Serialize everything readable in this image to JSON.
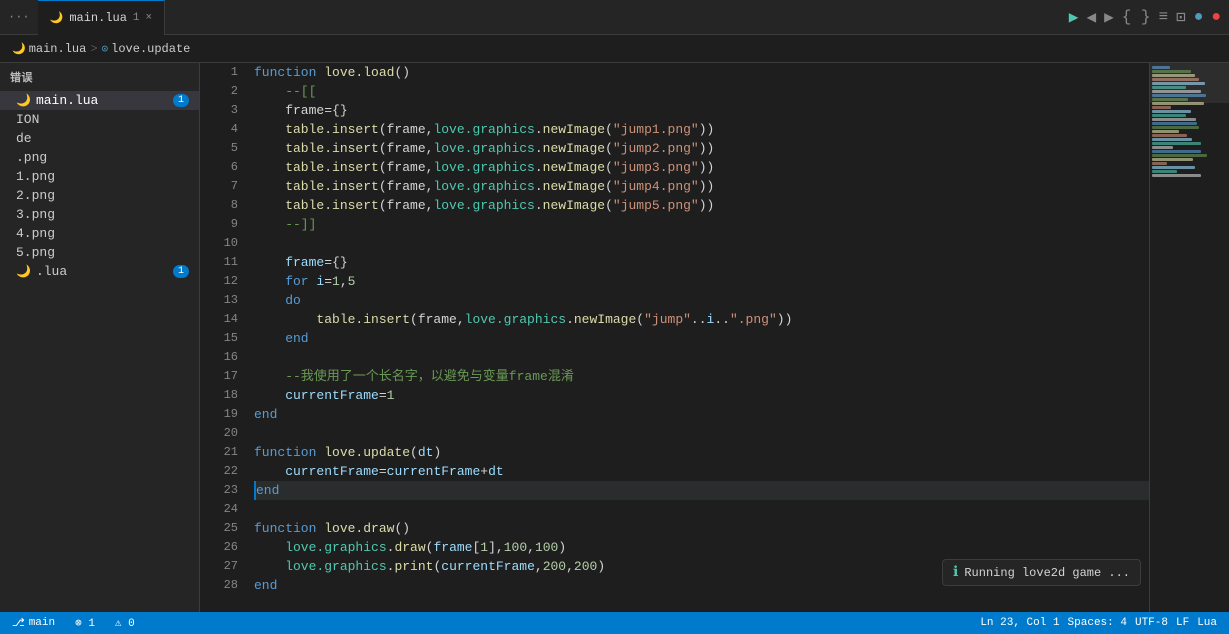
{
  "titlebar": {
    "ellipsis": "···",
    "tab_label": "main.lua",
    "tab_badge": "1",
    "tab_close": "×",
    "actions": [
      "▶",
      "◀",
      "▶",
      "{ }",
      "≡",
      "⊡",
      "●",
      "●"
    ]
  },
  "breadcrumb": {
    "file": "main.lua",
    "separator": ">",
    "symbol": "love.update"
  },
  "sidebar": {
    "sections": [
      {
        "name": "错误",
        "items": [
          {
            "label": "main.lua",
            "badge": "1",
            "active": true
          },
          {
            "label": "ION",
            "badge": null
          },
          {
            "label": "de",
            "badge": null
          },
          {
            "label": ".png",
            "badge": null
          },
          {
            "label": "1.png",
            "badge": null
          },
          {
            "label": "2.png",
            "badge": null
          },
          {
            "label": "3.png",
            "badge": null
          },
          {
            "label": "4.png",
            "badge": null
          },
          {
            "label": "5.png",
            "badge": null
          },
          {
            "label": ".lua",
            "badge": "1"
          }
        ]
      }
    ]
  },
  "code": {
    "lines": [
      {
        "num": 1,
        "tokens": [
          {
            "t": "kw",
            "v": "function "
          },
          {
            "t": "fn",
            "v": "love.load"
          },
          {
            "t": "op",
            "v": "()"
          }
        ]
      },
      {
        "num": 2,
        "tokens": [
          {
            "t": "comment",
            "v": "    --[["
          }
        ]
      },
      {
        "num": 3,
        "tokens": [
          {
            "t": "op",
            "v": "    frame={}"
          }
        ]
      },
      {
        "num": 4,
        "tokens": [
          {
            "t": "fn",
            "v": "    table.insert"
          },
          {
            "t": "op",
            "v": "(frame,"
          },
          {
            "t": "ns",
            "v": "love.graphics"
          },
          {
            "t": "op",
            "v": "."
          },
          {
            "t": "fn",
            "v": "newImage"
          },
          {
            "t": "op",
            "v": "("
          },
          {
            "t": "str",
            "v": "\"jump1.png\""
          },
          {
            "t": "op",
            "v": "))"
          }
        ]
      },
      {
        "num": 5,
        "tokens": [
          {
            "t": "fn",
            "v": "    table.insert"
          },
          {
            "t": "op",
            "v": "(frame,"
          },
          {
            "t": "ns",
            "v": "love.graphics"
          },
          {
            "t": "op",
            "v": "."
          },
          {
            "t": "fn",
            "v": "newImage"
          },
          {
            "t": "op",
            "v": "("
          },
          {
            "t": "str",
            "v": "\"jump2.png\""
          },
          {
            "t": "op",
            "v": "))"
          }
        ]
      },
      {
        "num": 6,
        "tokens": [
          {
            "t": "fn",
            "v": "    table.insert"
          },
          {
            "t": "op",
            "v": "(frame,"
          },
          {
            "t": "ns",
            "v": "love.graphics"
          },
          {
            "t": "op",
            "v": "."
          },
          {
            "t": "fn",
            "v": "newImage"
          },
          {
            "t": "op",
            "v": "("
          },
          {
            "t": "str",
            "v": "\"jump3.png\""
          },
          {
            "t": "op",
            "v": "))"
          }
        ]
      },
      {
        "num": 7,
        "tokens": [
          {
            "t": "fn",
            "v": "    table.insert"
          },
          {
            "t": "op",
            "v": "(frame,"
          },
          {
            "t": "ns",
            "v": "love.graphics"
          },
          {
            "t": "op",
            "v": "."
          },
          {
            "t": "fn",
            "v": "newImage"
          },
          {
            "t": "op",
            "v": "("
          },
          {
            "t": "str",
            "v": "\"jump4.png\""
          },
          {
            "t": "op",
            "v": "))"
          }
        ]
      },
      {
        "num": 8,
        "tokens": [
          {
            "t": "fn",
            "v": "    table.insert"
          },
          {
            "t": "op",
            "v": "(frame,"
          },
          {
            "t": "ns",
            "v": "love.graphics"
          },
          {
            "t": "op",
            "v": "."
          },
          {
            "t": "fn",
            "v": "newImage"
          },
          {
            "t": "op",
            "v": "("
          },
          {
            "t": "str",
            "v": "\"jump5.png\""
          },
          {
            "t": "op",
            "v": "))"
          }
        ]
      },
      {
        "num": 9,
        "tokens": [
          {
            "t": "comment",
            "v": "    --]]"
          }
        ]
      },
      {
        "num": 10,
        "tokens": []
      },
      {
        "num": 11,
        "tokens": [
          {
            "t": "var",
            "v": "    frame"
          },
          {
            "t": "op",
            "v": "={}"
          }
        ]
      },
      {
        "num": 12,
        "tokens": [
          {
            "t": "kw",
            "v": "    for "
          },
          {
            "t": "var",
            "v": "i"
          },
          {
            "t": "op",
            "v": "="
          },
          {
            "t": "num",
            "v": "1"
          },
          {
            "t": "op",
            "v": ","
          },
          {
            "t": "num",
            "v": "5"
          }
        ]
      },
      {
        "num": 13,
        "tokens": [
          {
            "t": "kw",
            "v": "    do"
          }
        ]
      },
      {
        "num": 14,
        "tokens": [
          {
            "t": "fn",
            "v": "        table.insert"
          },
          {
            "t": "op",
            "v": "(frame,"
          },
          {
            "t": "ns",
            "v": "love.graphics"
          },
          {
            "t": "op",
            "v": "."
          },
          {
            "t": "fn",
            "v": "newImage"
          },
          {
            "t": "op",
            "v": "("
          },
          {
            "t": "str",
            "v": "\"jump\""
          },
          {
            "t": "op",
            "v": ".."
          },
          {
            "t": "var",
            "v": "i"
          },
          {
            "t": "op",
            "v": ".."
          },
          {
            "t": "str",
            "v": "\".png\""
          },
          {
            "t": "op",
            "v": "))"
          }
        ]
      },
      {
        "num": 15,
        "tokens": [
          {
            "t": "kw",
            "v": "    end"
          }
        ]
      },
      {
        "num": 16,
        "tokens": []
      },
      {
        "num": 17,
        "tokens": [
          {
            "t": "comment",
            "v": "    --我使用了一个长名字，以避免与变量frame混淆"
          }
        ]
      },
      {
        "num": 18,
        "tokens": [
          {
            "t": "var",
            "v": "    currentFrame"
          },
          {
            "t": "op",
            "v": "="
          },
          {
            "t": "num",
            "v": "1"
          }
        ]
      },
      {
        "num": 19,
        "tokens": [
          {
            "t": "kw",
            "v": "end"
          }
        ]
      },
      {
        "num": 20,
        "tokens": []
      },
      {
        "num": 21,
        "tokens": [
          {
            "t": "kw",
            "v": "function "
          },
          {
            "t": "fn",
            "v": "love.update"
          },
          {
            "t": "op",
            "v": "("
          },
          {
            "t": "var",
            "v": "dt"
          },
          {
            "t": "op",
            "v": ")"
          }
        ]
      },
      {
        "num": 22,
        "tokens": [
          {
            "t": "var",
            "v": "    currentFrame"
          },
          {
            "t": "op",
            "v": "="
          },
          {
            "t": "var",
            "v": "currentFrame"
          },
          {
            "t": "op",
            "v": "+"
          },
          {
            "t": "var",
            "v": "dt"
          }
        ]
      },
      {
        "num": 23,
        "tokens": [
          {
            "t": "kw",
            "v": "end"
          }
        ],
        "active": true
      },
      {
        "num": 24,
        "tokens": []
      },
      {
        "num": 25,
        "tokens": [
          {
            "t": "kw",
            "v": "function "
          },
          {
            "t": "fn",
            "v": "love.draw"
          },
          {
            "t": "op",
            "v": "()"
          }
        ]
      },
      {
        "num": 26,
        "tokens": [
          {
            "t": "ns",
            "v": "    love.graphics"
          },
          {
            "t": "op",
            "v": "."
          },
          {
            "t": "fn",
            "v": "draw"
          },
          {
            "t": "op",
            "v": "("
          },
          {
            "t": "var",
            "v": "frame"
          },
          {
            "t": "op",
            "v": "["
          },
          {
            "t": "num",
            "v": "1"
          },
          {
            "t": "op",
            "v": "],"
          },
          {
            "t": "num",
            "v": "100"
          },
          {
            "t": "op",
            "v": ","
          },
          {
            "t": "num",
            "v": "100"
          },
          {
            "t": "op",
            "v": ")"
          }
        ]
      },
      {
        "num": 27,
        "tokens": [
          {
            "t": "ns",
            "v": "    love.graphics"
          },
          {
            "t": "op",
            "v": "."
          },
          {
            "t": "fn",
            "v": "print"
          },
          {
            "t": "op",
            "v": "("
          },
          {
            "t": "var",
            "v": "currentFrame"
          },
          {
            "t": "op",
            "v": ","
          },
          {
            "t": "num",
            "v": "200"
          },
          {
            "t": "op",
            "v": ","
          },
          {
            "t": "num",
            "v": "200"
          },
          {
            "t": "op",
            "v": ")"
          }
        ]
      },
      {
        "num": 28,
        "tokens": [
          {
            "t": "kw",
            "v": "end"
          }
        ]
      }
    ]
  },
  "running": {
    "icon": "ℹ",
    "text": "Running love2d game ..."
  },
  "statusbar": {
    "branch": "main",
    "errors": "⊗ 1",
    "warnings": "⚠ 0",
    "line_col": "Ln 23, Col 1",
    "spaces": "Spaces: 4",
    "encoding": "UTF-8",
    "eol": "LF",
    "language": "Lua"
  }
}
